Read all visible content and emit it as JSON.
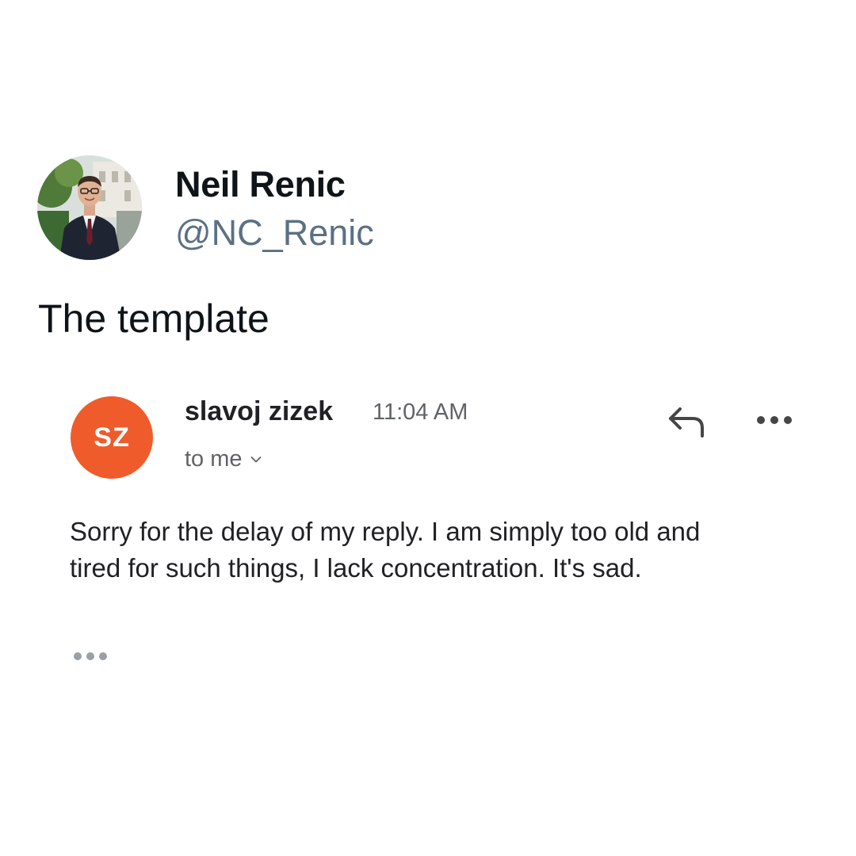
{
  "tweet": {
    "author": {
      "display_name": "Neil Renic",
      "handle": "@NC_Renic",
      "avatar": "profile-photo"
    },
    "text": "The template"
  },
  "email": {
    "sender": {
      "name": "slavoj zizek",
      "initials": "SZ",
      "avatar_color": "#f05b2b"
    },
    "time": "11:04 AM",
    "recipient_label": "to me",
    "actions": {
      "reply_icon": "reply-icon",
      "more_icon": "more-options-icon"
    },
    "body_lines": [
      "Sorry for the delay of my reply. I am simply too old and",
      "tired for such things, I lack concentration. It's sad."
    ],
    "trimmed_content_icon": "ellipsis-icon"
  },
  "colors": {
    "handle": "#5b7083",
    "secondary_text": "#5f6368",
    "icon": "#444746"
  }
}
